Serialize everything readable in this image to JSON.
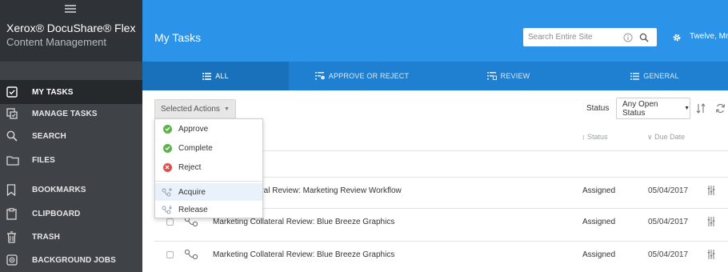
{
  "sidebar": {
    "brand_title": "Xerox® DocuShare® Flex",
    "brand_subtitle": "Content Management",
    "items": [
      {
        "label": "MY TASKS",
        "icon": "checkbox-icon",
        "active": true
      },
      {
        "label": "MANAGE TASKS",
        "icon": "manage-tasks-icon"
      },
      {
        "label": "SEARCH",
        "icon": "search-icon"
      },
      {
        "label": "FILES",
        "icon": "folder-icon"
      },
      {
        "label": "BOOKMARKS",
        "icon": "bookmark-icon"
      },
      {
        "label": "CLIPBOARD",
        "icon": "clipboard-icon"
      },
      {
        "label": "TRASH",
        "icon": "trash-icon"
      },
      {
        "label": "BACKGROUND JOBS",
        "icon": "background-jobs-icon"
      }
    ]
  },
  "header": {
    "title": "My Tasks",
    "search_placeholder": "Search Entire Site",
    "user": "Twelve, Mr"
  },
  "tabs": [
    {
      "label": "ALL",
      "icon": "list-icon",
      "active": true
    },
    {
      "label": "APPROVE OR REJECT",
      "icon": "approve-list-icon"
    },
    {
      "label": "REVIEW",
      "icon": "review-list-icon"
    },
    {
      "label": "GENERAL",
      "icon": "list-icon"
    }
  ],
  "toolbar": {
    "actions_label": "Selected Actions",
    "status_label": "Status",
    "status_value": "Any Open Status"
  },
  "columns": {
    "status": "↕ Status",
    "due_date": "∨ Due Date"
  },
  "dropdown": {
    "items": [
      {
        "label": "Approve",
        "icon": "approve-icon",
        "color": "#5fb14d"
      },
      {
        "label": "Complete",
        "icon": "complete-icon",
        "color": "#5fb14d"
      },
      {
        "label": "Reject",
        "icon": "reject-icon",
        "color": "#e24c4c"
      },
      {
        "label": "Acquire",
        "icon": "acquire-icon",
        "hover": true
      },
      {
        "label": "Release",
        "icon": "release-icon"
      }
    ]
  },
  "rows": [
    {
      "title": "Marketing Collateral Review: Marketing Review Workflow",
      "visible_title": "teral Review: Marketing Review Workflow",
      "status": "Assigned",
      "due": "05/04/2017"
    },
    {
      "title": "Marketing Collateral Review: Blue Breeze Graphics",
      "visible_title": "Marketing Collateral Review: Blue Breeze Graphics",
      "status": "Assigned",
      "due": "05/04/2017"
    },
    {
      "title": "Marketing Collateral Review: Blue Breeze Graphics",
      "visible_title": "Marketing Collateral Review: Blue Breeze Graphics",
      "status": "Assigned",
      "due": "05/04/2017"
    }
  ],
  "colors": {
    "header": "#2b93e8",
    "tabs": "#1f7fd0",
    "sidebar": "#3f4347",
    "approve": "#5fb14d",
    "reject": "#e24c4c"
  }
}
